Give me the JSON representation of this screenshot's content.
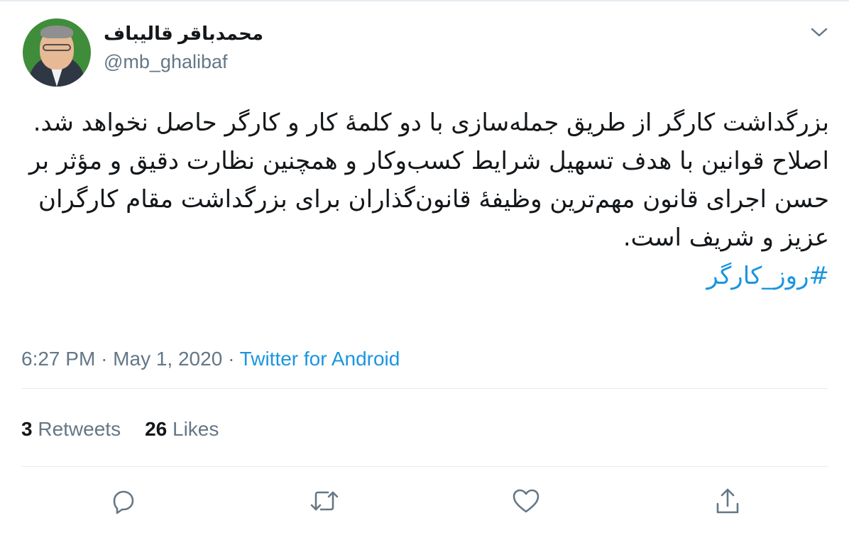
{
  "profile": {
    "display_name": "محمدباقر قالیباف",
    "handle": "@mb_ghalibaf"
  },
  "tweet": {
    "text": "بزرگداشت کارگر از طریق جمله‌سازی با دو کلمهٔ کار و کارگر حاصل نخواهد شد. اصلاح قوانین با هدف تسهیل شرایط کسب‌وکار و همچنین نظارت دقیق و مؤثر بر حسن اجرای قانون مهم‌ترین وظیفهٔ قانون‌گذاران برای بزرگداشت مقام کارگران عزیز و شریف است.",
    "hashtag": "#روز_کارگر"
  },
  "meta": {
    "time": "6:27 PM",
    "separator": "·",
    "date": "May 1, 2020",
    "source": "Twitter for Android"
  },
  "stats": {
    "retweets_count": "3",
    "retweets_label": "Retweets",
    "likes_count": "26",
    "likes_label": "Likes"
  },
  "icons": {
    "menu": "chevron-down-icon",
    "reply": "reply-icon",
    "retweet": "retweet-icon",
    "like": "heart-icon",
    "share": "share-icon"
  },
  "colors": {
    "link": "#1b95e0",
    "secondary_text": "#657786",
    "primary_text": "#14171a",
    "divider": "#e6ecf0"
  }
}
